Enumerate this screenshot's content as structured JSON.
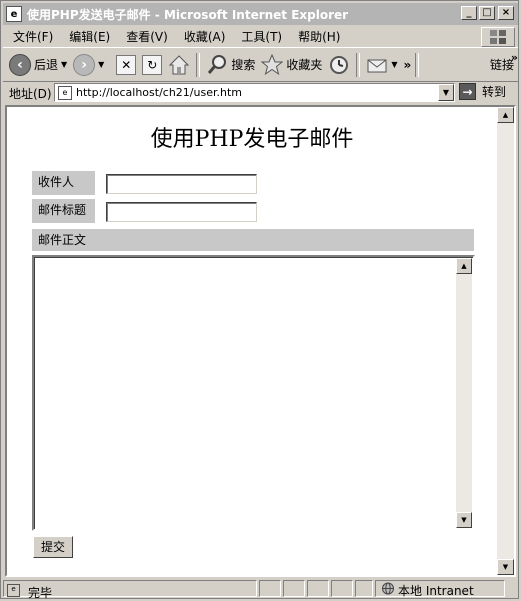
{
  "window": {
    "title": "使用PHP发送电子邮件 - Microsoft Internet Explorer",
    "min_glyph": "_",
    "max_glyph": "□",
    "close_glyph": "×"
  },
  "menu": [
    "文件(F)",
    "编辑(E)",
    "查看(V)",
    "收藏(A)",
    "工具(T)",
    "帮助(H)"
  ],
  "toolbar": {
    "back_label": "后退",
    "search_label": "搜索",
    "favorites_label": "收藏夹",
    "links_label": "链接"
  },
  "address": {
    "label": "地址(D)",
    "url": "http://localhost/ch21/user.htm",
    "go_label": "转到"
  },
  "page": {
    "heading": "使用PHP发电子邮件",
    "recipient_label": "收件人",
    "recipient_value": "",
    "subject_label": "邮件标题",
    "subject_value": "",
    "body_label": "邮件正文",
    "body_value": "",
    "submit_label": "提交"
  },
  "status": {
    "text": "完毕",
    "zone": "本地 Intranet"
  },
  "icons": [
    "ie-page-icon",
    "back-arrow-icon",
    "forward-arrow-icon",
    "stop-icon",
    "refresh-icon",
    "home-icon",
    "search-icon",
    "favorites-star-icon",
    "history-icon",
    "mail-icon",
    "windows-logo-icon",
    "go-arrow-icon",
    "intranet-icon"
  ]
}
